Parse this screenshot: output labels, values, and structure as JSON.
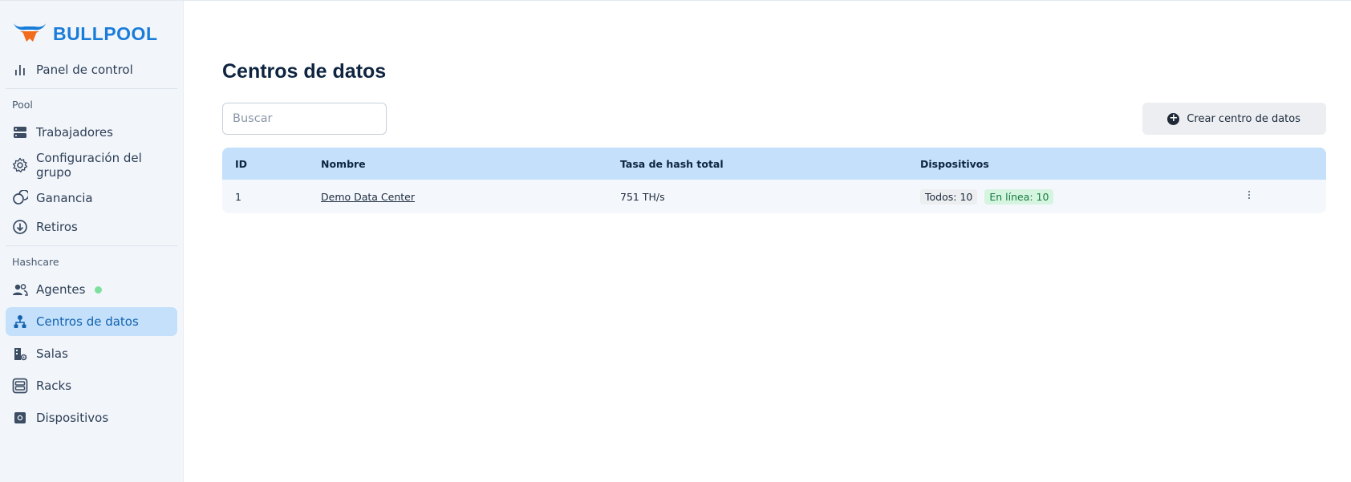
{
  "brand": {
    "name": "BULLPOOL",
    "logo_icon": "bull-icon",
    "color": "#1a7cd9",
    "accent": "#f26b1d"
  },
  "sidebar": {
    "top_item": {
      "label": "Panel de control",
      "icon": "bar-chart-icon"
    },
    "sections": [
      {
        "title": "Pool",
        "items": [
          {
            "label": "Trabajadores",
            "icon": "server-icon"
          },
          {
            "label": "Configuración del grupo",
            "icon": "gear-icon"
          },
          {
            "label": "Ganancia",
            "icon": "coins-icon"
          },
          {
            "label": "Retiros",
            "icon": "download-circle-icon"
          }
        ]
      },
      {
        "title": "Hashcare",
        "items": [
          {
            "label": "Agentes",
            "icon": "users-icon",
            "status": "online"
          },
          {
            "label": "Centros de datos",
            "icon": "hierarchy-icon",
            "active": true
          },
          {
            "label": "Salas",
            "icon": "building-gear-icon"
          },
          {
            "label": "Racks",
            "icon": "rack-icon"
          },
          {
            "label": "Dispositivos",
            "icon": "chip-icon"
          }
        ]
      }
    ]
  },
  "page": {
    "title": "Centros de datos",
    "search_placeholder": "Buscar",
    "create_button": "Crear centro de datos"
  },
  "table": {
    "columns": [
      "ID",
      "Nombre",
      "Tasa de hash total",
      "Dispositivos"
    ],
    "rows": [
      {
        "id": "1",
        "name": "Demo Data Center",
        "hashrate": "751 TH/s",
        "devices_all": "Todos: 10",
        "devices_online": "En línea: 10"
      }
    ]
  },
  "colors": {
    "active_bg": "#c4e0fb",
    "header_bg": "#c4e0fb",
    "online_badge": "#d5f5e0"
  }
}
